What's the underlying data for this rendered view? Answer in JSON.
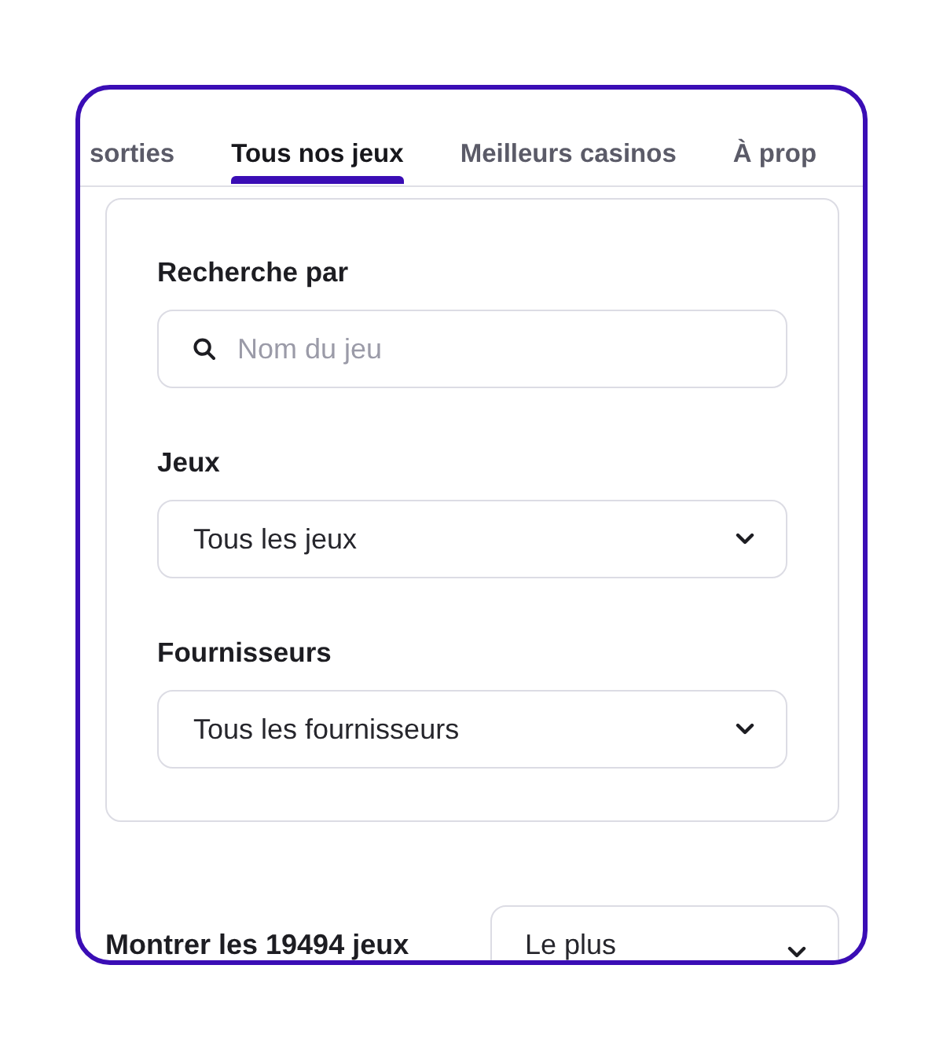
{
  "tabs": [
    {
      "label": "sorties",
      "selected": false
    },
    {
      "label": "Tous nos jeux",
      "selected": true
    },
    {
      "label": "Meilleurs casinos",
      "selected": false
    },
    {
      "label": "À prop",
      "selected": false
    }
  ],
  "filters": {
    "fields": [
      {
        "kind": "search",
        "label": "Recherche par",
        "placeholder": "Nom du jeu"
      },
      {
        "kind": "select",
        "label": "Jeux",
        "value": "Tous les jeux"
      },
      {
        "kind": "select",
        "label": "Fournisseurs",
        "value": "Tous les fournisseurs"
      }
    ]
  },
  "results": {
    "count_text": "Montrer les 19494 jeux",
    "sort": {
      "value": "Le plus"
    }
  }
}
